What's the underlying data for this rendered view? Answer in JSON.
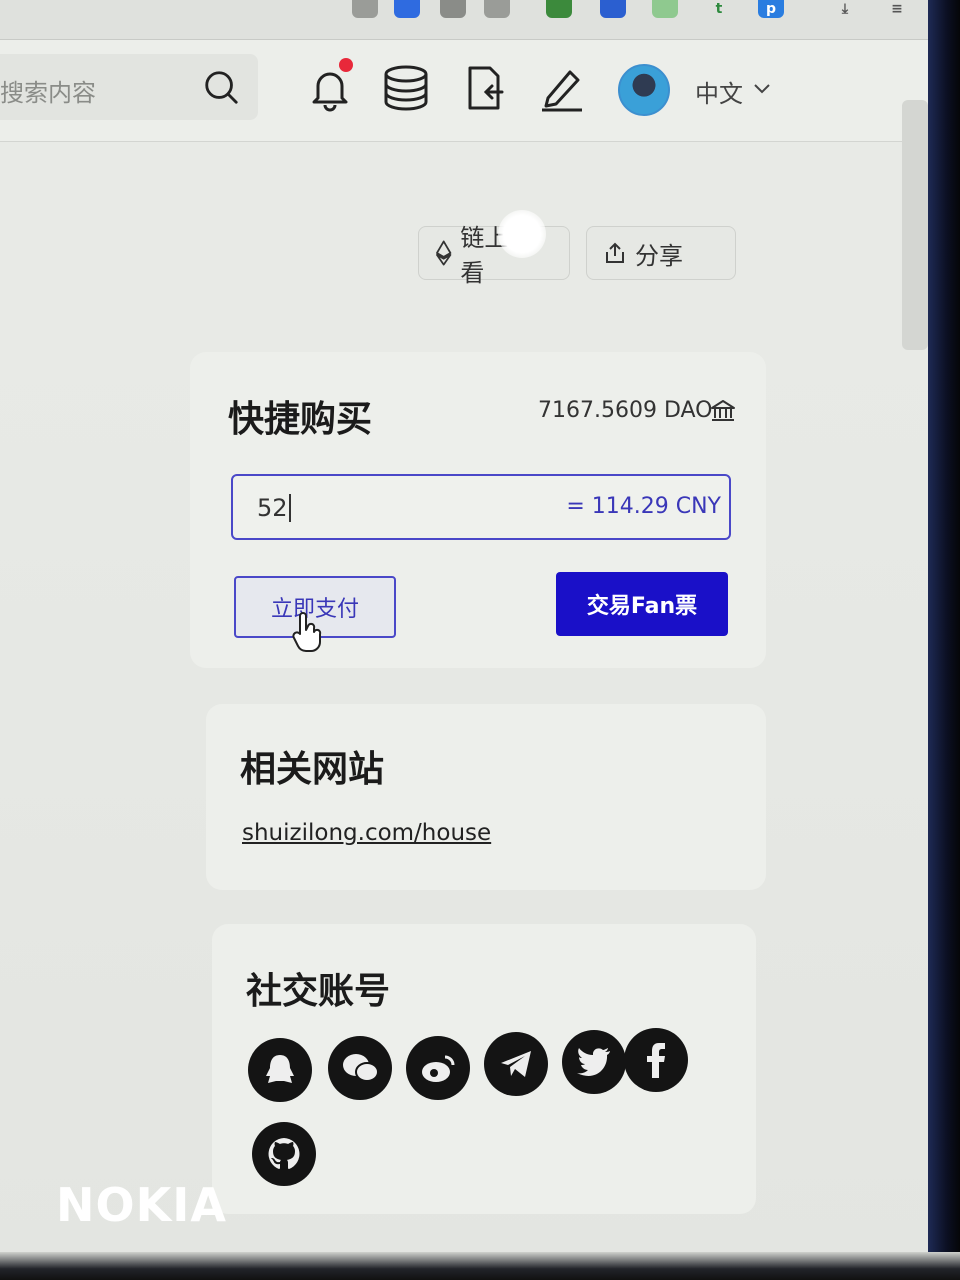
{
  "header": {
    "search_placeholder": "搜索内容",
    "language": "中文"
  },
  "actions": {
    "chain_view_label": "链上查看",
    "share_label": "分享"
  },
  "quick_buy": {
    "title": "快捷购买",
    "balance": "7167.5609 DAO",
    "amount_value": "52",
    "amount_cny": "= 114.29 CNY",
    "pay_label": "立即支付",
    "trade_label": "交易Fan票"
  },
  "related_sites": {
    "title": "相关网站",
    "link": "shuizilong.com/house"
  },
  "social_accounts": {
    "title": "社交账号",
    "icons": [
      "qq-icon",
      "wechat-icon",
      "weibo-icon",
      "telegram-icon",
      "twitter-icon",
      "facebook-icon",
      "github-icon"
    ]
  },
  "watermark": "NOKIA",
  "colors": {
    "primary": "#1a10c8",
    "accent_border": "#4a48c8",
    "notification": "#e8283a"
  }
}
